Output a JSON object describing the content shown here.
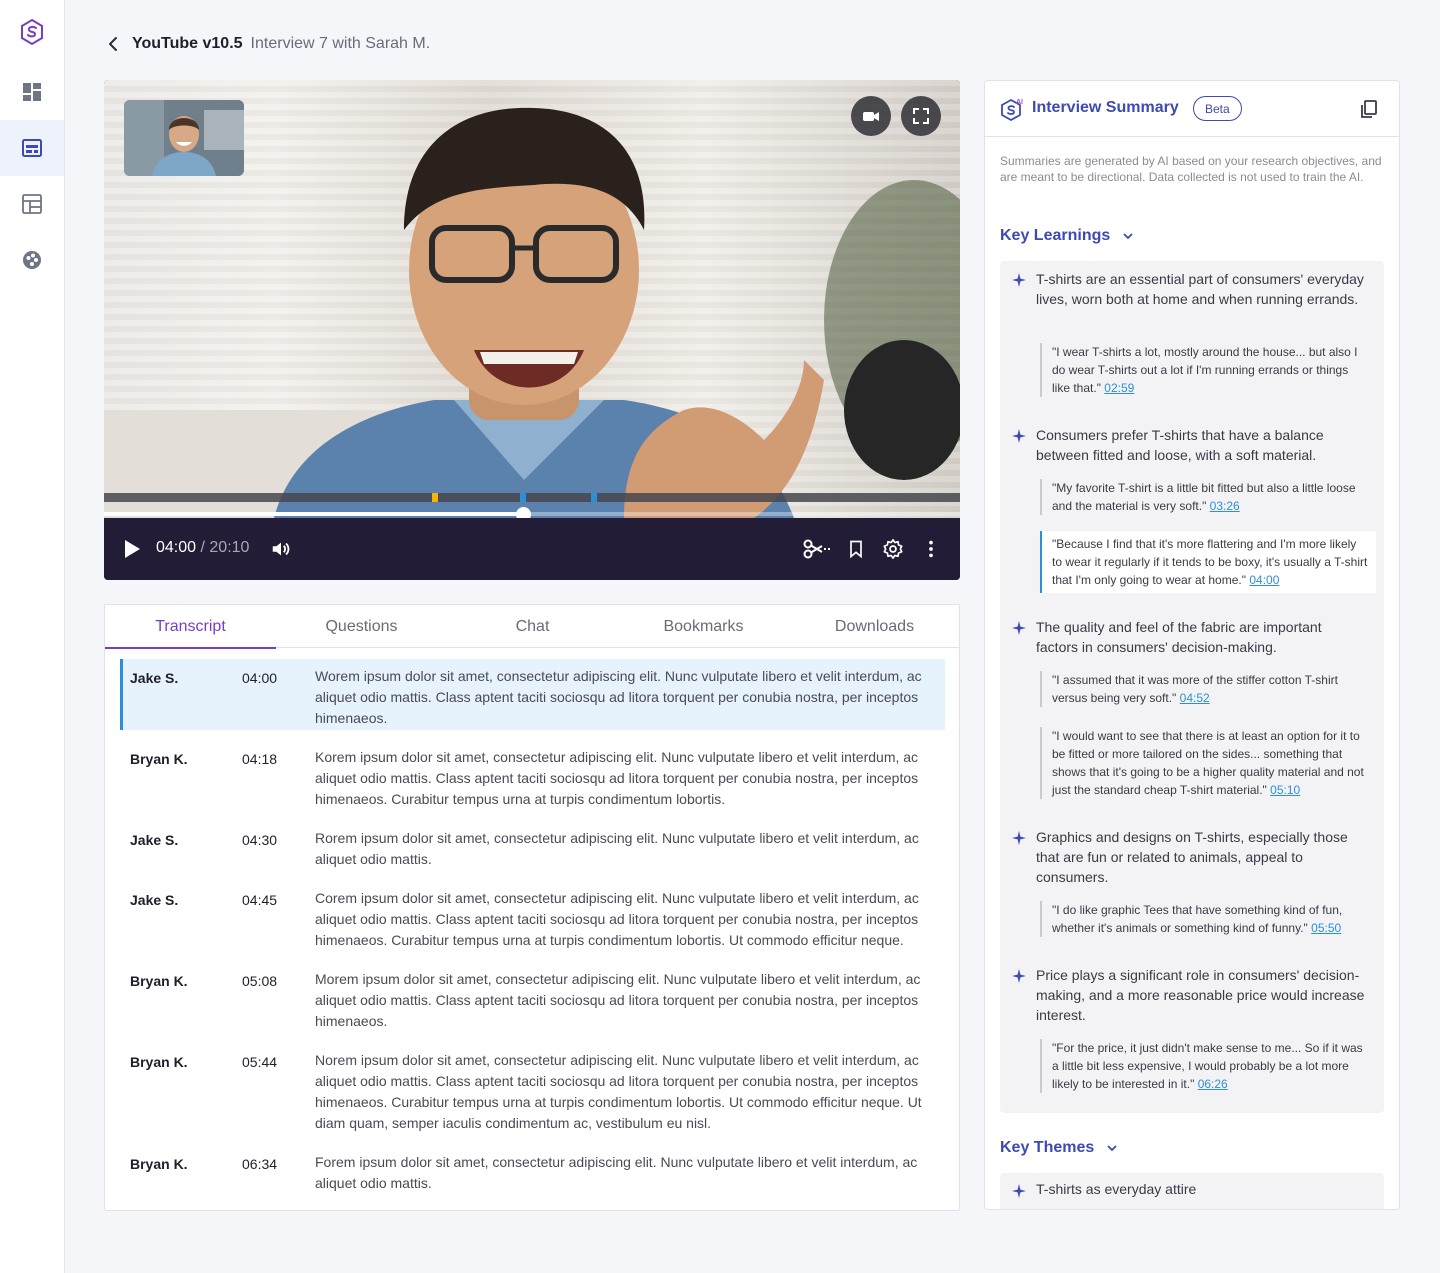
{
  "breadcrumb": {
    "title": "YouTube v10.5",
    "subtitle": "Interview 7 with Sarah M."
  },
  "sidebar": {
    "items": [
      {
        "icon": "dashboard-icon"
      },
      {
        "icon": "layout-icon",
        "active": true
      },
      {
        "icon": "template-icon"
      },
      {
        "icon": "palette-icon"
      }
    ]
  },
  "video": {
    "current_time": "04:00",
    "separator": " / ",
    "duration": "20:10",
    "progress": 0.49,
    "markers": [
      {
        "position": 0.387,
        "color": "#f4b400"
      },
      {
        "position": 0.49,
        "color": "#2d8fd6"
      },
      {
        "position": 0.572,
        "color": "#2d8fd6"
      }
    ]
  },
  "tabs": [
    "Transcript",
    "Questions",
    "Chat",
    "Bookmarks",
    "Downloads"
  ],
  "transcript": [
    {
      "speaker": "Jake S.",
      "time": "04:00",
      "text": "Worem ipsum dolor sit amet, consectetur adipiscing elit. Nunc vulputate libero et velit interdum, ac aliquet odio mattis. Class aptent taciti sociosqu ad litora torquent per conubia nostra, per inceptos himenaeos."
    },
    {
      "speaker": "Bryan K.",
      "time": "04:18",
      "text": "Korem ipsum dolor sit amet, consectetur adipiscing elit. Nunc vulputate libero et velit interdum, ac aliquet odio mattis. Class aptent taciti sociosqu ad litora torquent per conubia nostra, per inceptos himenaeos. Curabitur tempus urna at turpis condimentum lobortis."
    },
    {
      "speaker": "Jake S.",
      "time": "04:30",
      "text": "Rorem ipsum dolor sit amet, consectetur adipiscing elit. Nunc vulputate libero et velit interdum, ac aliquet odio mattis."
    },
    {
      "speaker": "Jake S.",
      "time": "04:45",
      "text": "Corem ipsum dolor sit amet, consectetur adipiscing elit. Nunc vulputate libero et velit interdum, ac aliquet odio mattis. Class aptent taciti sociosqu ad litora torquent per conubia nostra, per inceptos himenaeos. Curabitur tempus urna at turpis condimentum lobortis. Ut commodo efficitur neque."
    },
    {
      "speaker": "Bryan K.",
      "time": "05:08",
      "text": "Morem ipsum dolor sit amet, consectetur adipiscing elit. Nunc vulputate libero et velit interdum, ac aliquet odio mattis. Class aptent taciti sociosqu ad litora torquent per conubia nostra, per inceptos himenaeos."
    },
    {
      "speaker": "Bryan K.",
      "time": "05:44",
      "text": "Norem ipsum dolor sit amet, consectetur adipiscing elit. Nunc vulputate libero et velit interdum, ac aliquet odio mattis. Class aptent taciti sociosqu ad litora torquent per conubia nostra, per inceptos himenaeos. Curabitur tempus urna at turpis condimentum lobortis. Ut commodo efficitur neque. Ut diam quam, semper iaculis condimentum ac, vestibulum eu nisl."
    },
    {
      "speaker": "Bryan K.",
      "time": "06:34",
      "text": "Forem ipsum dolor sit amet, consectetur adipiscing elit. Nunc vulputate libero et velit interdum, ac aliquet odio mattis."
    }
  ],
  "summary": {
    "title": "Interview Summary",
    "badge": "Beta",
    "disclaimer": "Summaries are generated by AI based on your research objectives, and are meant to be directional. Data collected is not used to train the AI.",
    "key_learnings_label": "Key Learnings",
    "learnings": [
      {
        "text": "T-shirts are an essential part of consumers' everyday lives, worn both at home and when running errands.",
        "quotes": [
          {
            "text": " \"I wear T-shirts a lot, mostly around the house... but also I do wear T-shirts out a lot if I'm running errands or things like that.\"",
            "ts": "02:59"
          }
        ]
      },
      {
        "text": "Consumers prefer T-shirts that have a balance between fitted and loose, with a soft material.",
        "quotes": [
          {
            "text": "\"My favorite T-shirt is a little bit fitted but also a little loose and the material is very soft.\"",
            "ts": "03:26"
          },
          {
            "text": "\"Because I find that it's more flattering and I'm more likely to wear it regularly if it tends to be boxy, it's usually a T-shirt that I'm only going to wear at home.\"",
            "ts": "04:00"
          }
        ]
      },
      {
        "text": "The quality and feel of the fabric are important factors in consumers' decision-making.",
        "quotes": [
          {
            "text": "\"I assumed that it was more of the stiffer cotton T-shirt versus being very soft.\"",
            "ts": "04:52"
          },
          {
            "text": "\"I would want to see that there is at least an option for it to be fitted or more tailored on the sides... something that shows that it's going to be a higher quality material and not just the standard cheap T-shirt material.\"",
            "ts": "05:10"
          }
        ]
      },
      {
        "text": "Graphics and designs on T-shirts, especially those that are fun or related to animals, appeal to consumers.",
        "quotes": [
          {
            "text": "\"I do like graphic Tees that have something kind of fun, whether it's animals or something kind of funny.\"",
            "ts": "05:50"
          }
        ]
      },
      {
        "text": "Price plays a significant role in consumers' decision-making, and a more reasonable price would increase interest.",
        "quotes": [
          {
            "text": "\"For the price, it just didn't make sense to me... So if it was a little bit less expensive, I would probably be a lot more likely to be interested in it.\"",
            "ts": "06:26"
          }
        ]
      }
    ],
    "key_themes_label": "Key Themes",
    "themes": [
      "T-shirts as everyday attire"
    ]
  },
  "colors": {
    "accent": "#7a3ec2",
    "brand": "#3e4ab4",
    "link": "#2d8fd6",
    "player_bar": "#221c36"
  }
}
